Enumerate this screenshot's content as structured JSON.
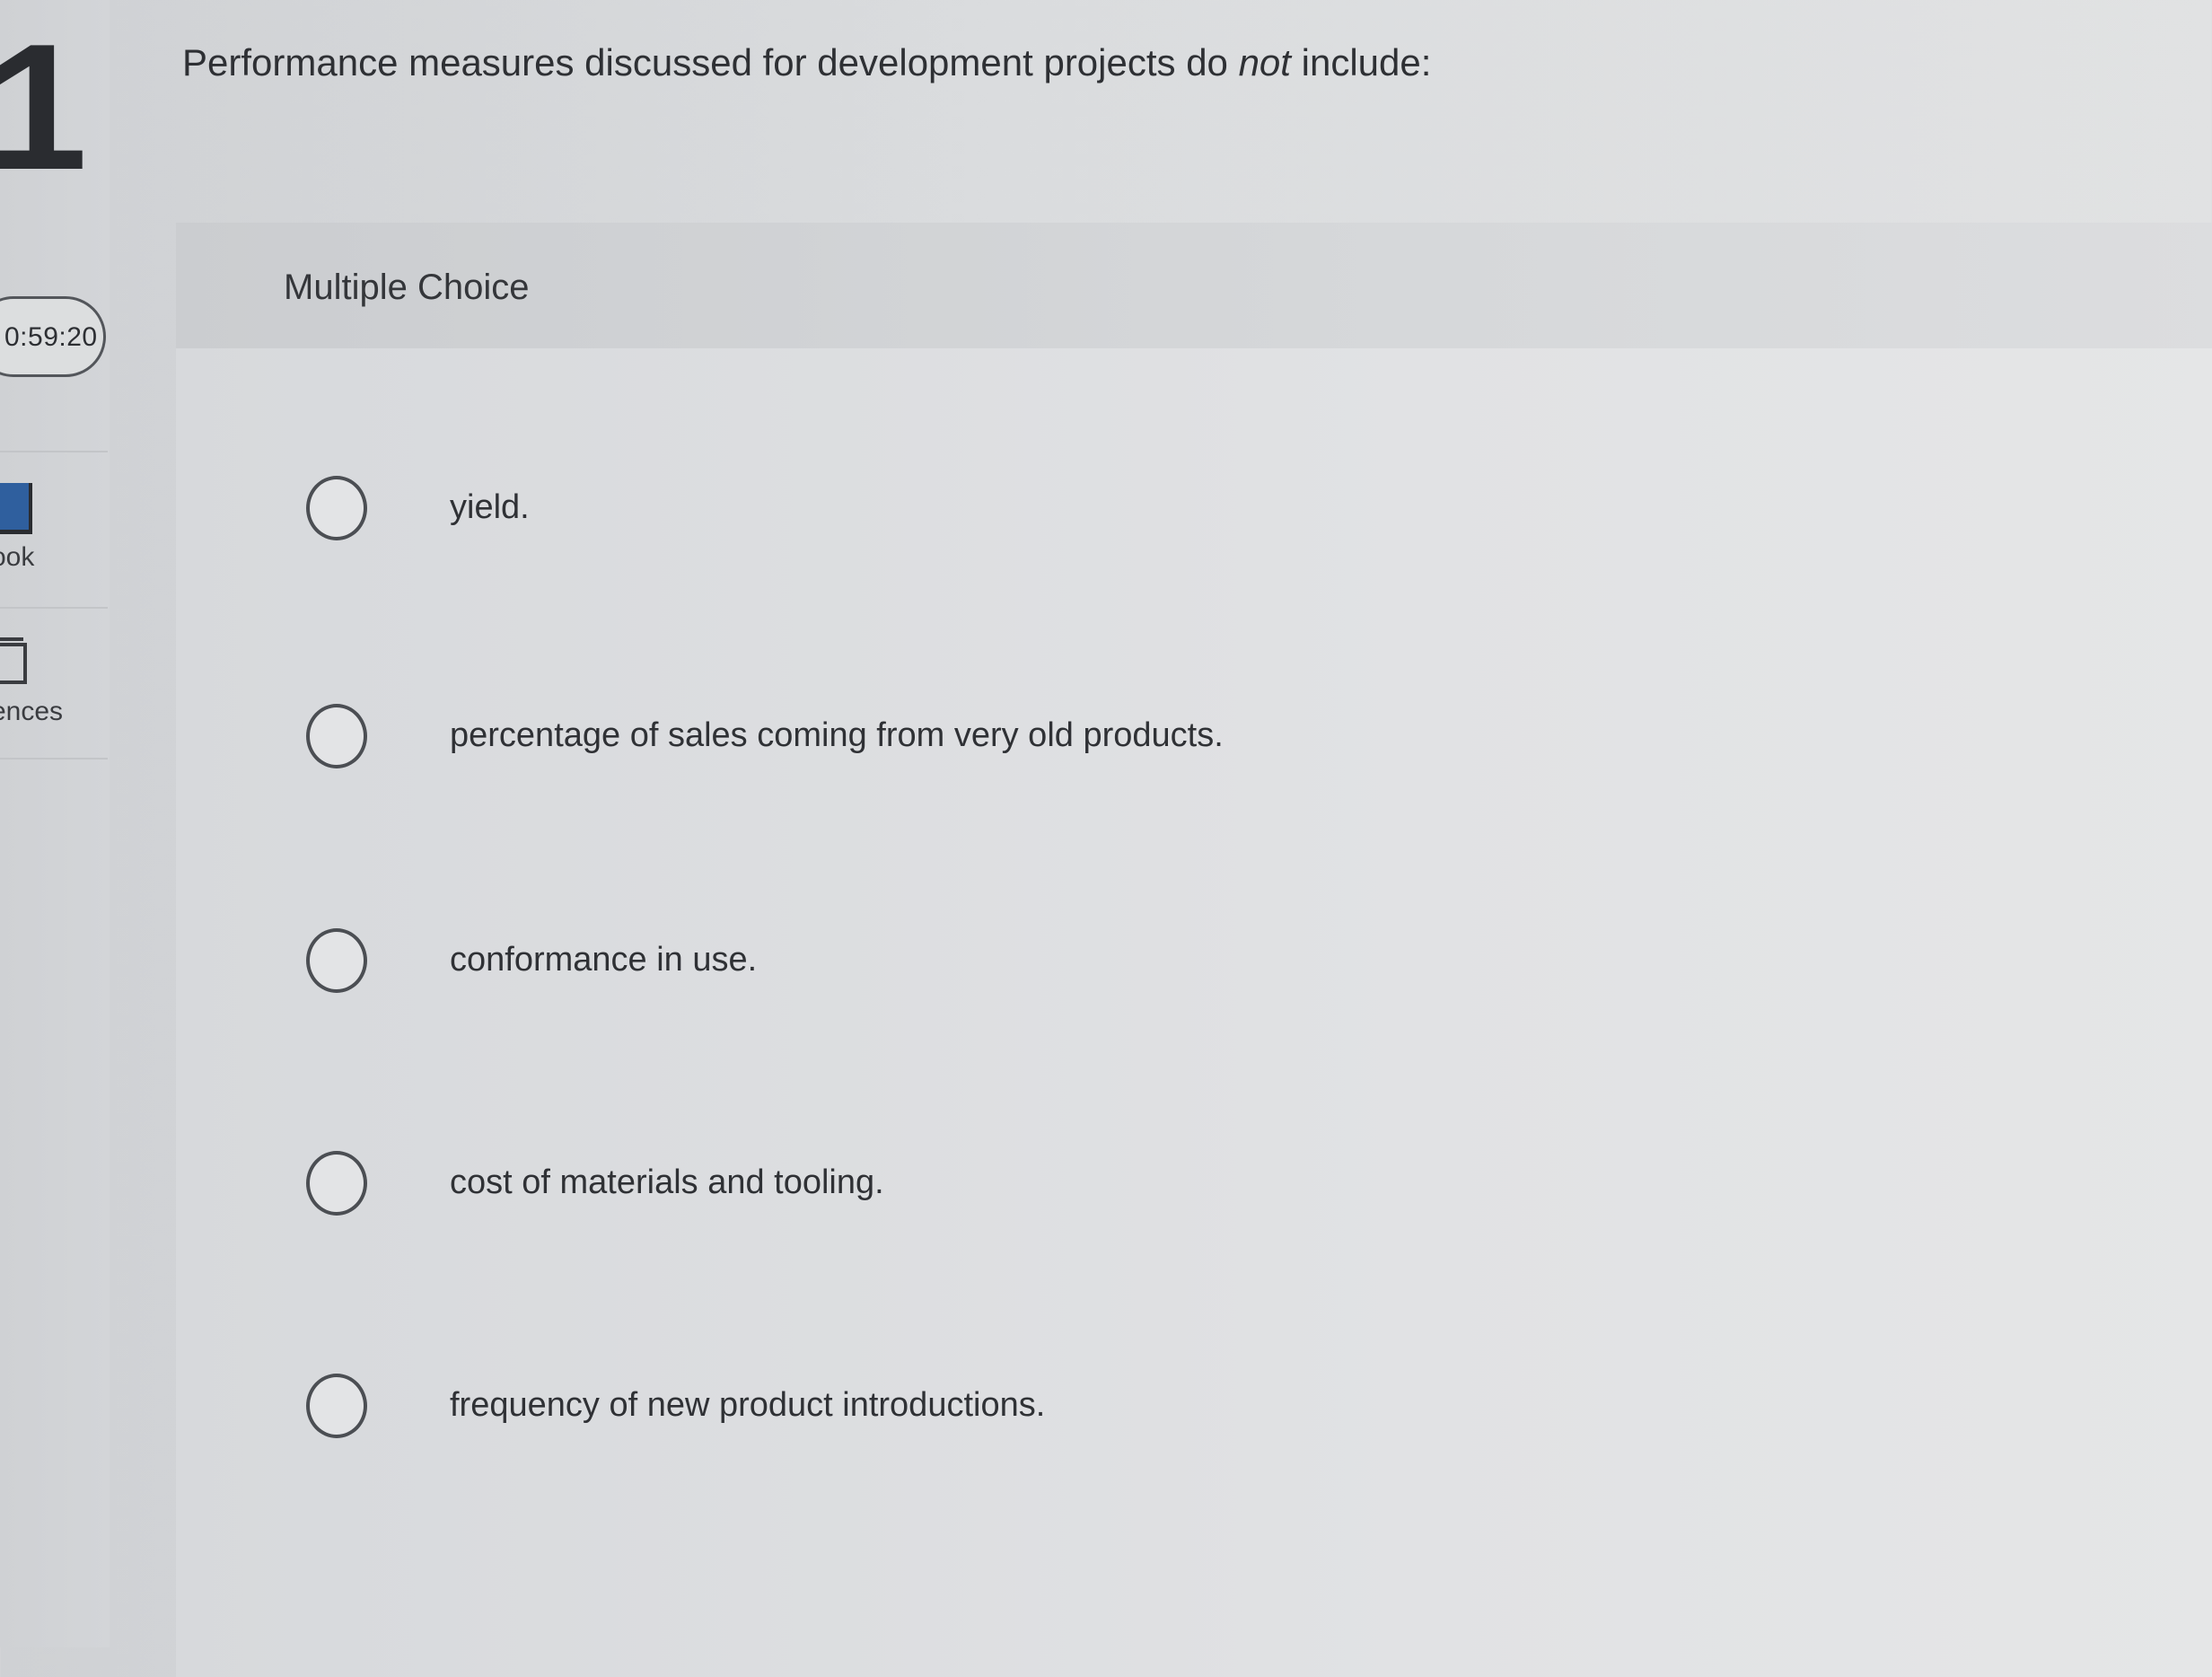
{
  "rail": {
    "question_number": "1",
    "timer": "0:59:20",
    "items": [
      {
        "label": "ook",
        "icon": "book-icon"
      },
      {
        "label": "ences",
        "icon": "references-icon"
      }
    ]
  },
  "question": {
    "text_before": "Performance measures discussed for development projects do ",
    "emphasis": "not",
    "text_after": " include:"
  },
  "answer_panel": {
    "type_label": "Multiple Choice",
    "options": [
      {
        "label": "yield."
      },
      {
        "label": "percentage of sales coming from very old products."
      },
      {
        "label": "conformance in use."
      },
      {
        "label": "cost of materials and tooling."
      },
      {
        "label": "frequency of new product introductions."
      }
    ]
  }
}
